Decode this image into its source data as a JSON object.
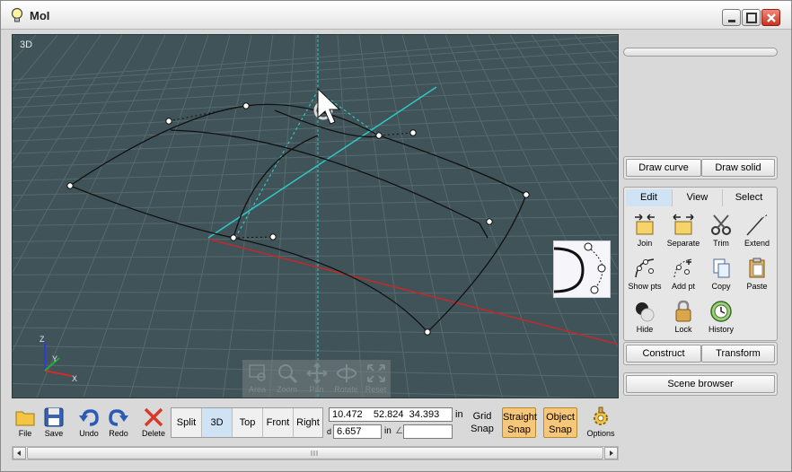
{
  "window": {
    "title": "MoI"
  },
  "viewport": {
    "label": "3D"
  },
  "view_tools": [
    {
      "name": "area",
      "label": "Area"
    },
    {
      "name": "zoom",
      "label": "Zoom"
    },
    {
      "name": "pan",
      "label": "Pan"
    },
    {
      "name": "rotate",
      "label": "Rotate"
    },
    {
      "name": "reset",
      "label": "Reset"
    }
  ],
  "axes": {
    "x": "X",
    "y": "Y",
    "z": "Z"
  },
  "right_panel": {
    "draw_curve": "Draw curve",
    "draw_solid": "Draw solid",
    "tabs": [
      "Edit",
      "View",
      "Select"
    ],
    "active_tab": "Edit",
    "tools": [
      "Join",
      "Separate",
      "Trim",
      "Extend",
      "Show pts",
      "Add pt",
      "Copy",
      "Paste",
      "Hide",
      "Lock",
      "History"
    ],
    "construct": "Construct",
    "transform": "Transform",
    "scene_browser": "Scene browser"
  },
  "bottom": {
    "file": "File",
    "save": "Save",
    "undo": "Undo",
    "redo": "Redo",
    "delete": "Delete",
    "views": [
      "Split",
      "3D",
      "Top",
      "Front",
      "Right"
    ],
    "active_view": "3D",
    "coords": "10.472    52.824  34.393",
    "units": "in",
    "distance_label": "d",
    "distance": "6.657",
    "distance_units": "in",
    "angle_symbol": "∠",
    "angle": "",
    "grid_snap": [
      "Grid",
      "Snap"
    ],
    "straight_snap": [
      "Straight",
      "Snap"
    ],
    "object_snap": [
      "Object",
      "Snap"
    ],
    "options": "Options"
  },
  "colors": {
    "viewport_bg": "#3f5358",
    "grid": "#566a6e",
    "axis_x": "#c62828",
    "axis_guide": "#2ec8c8",
    "snap_active": "#f6c77a",
    "tab_active": "#cfe3f5"
  }
}
